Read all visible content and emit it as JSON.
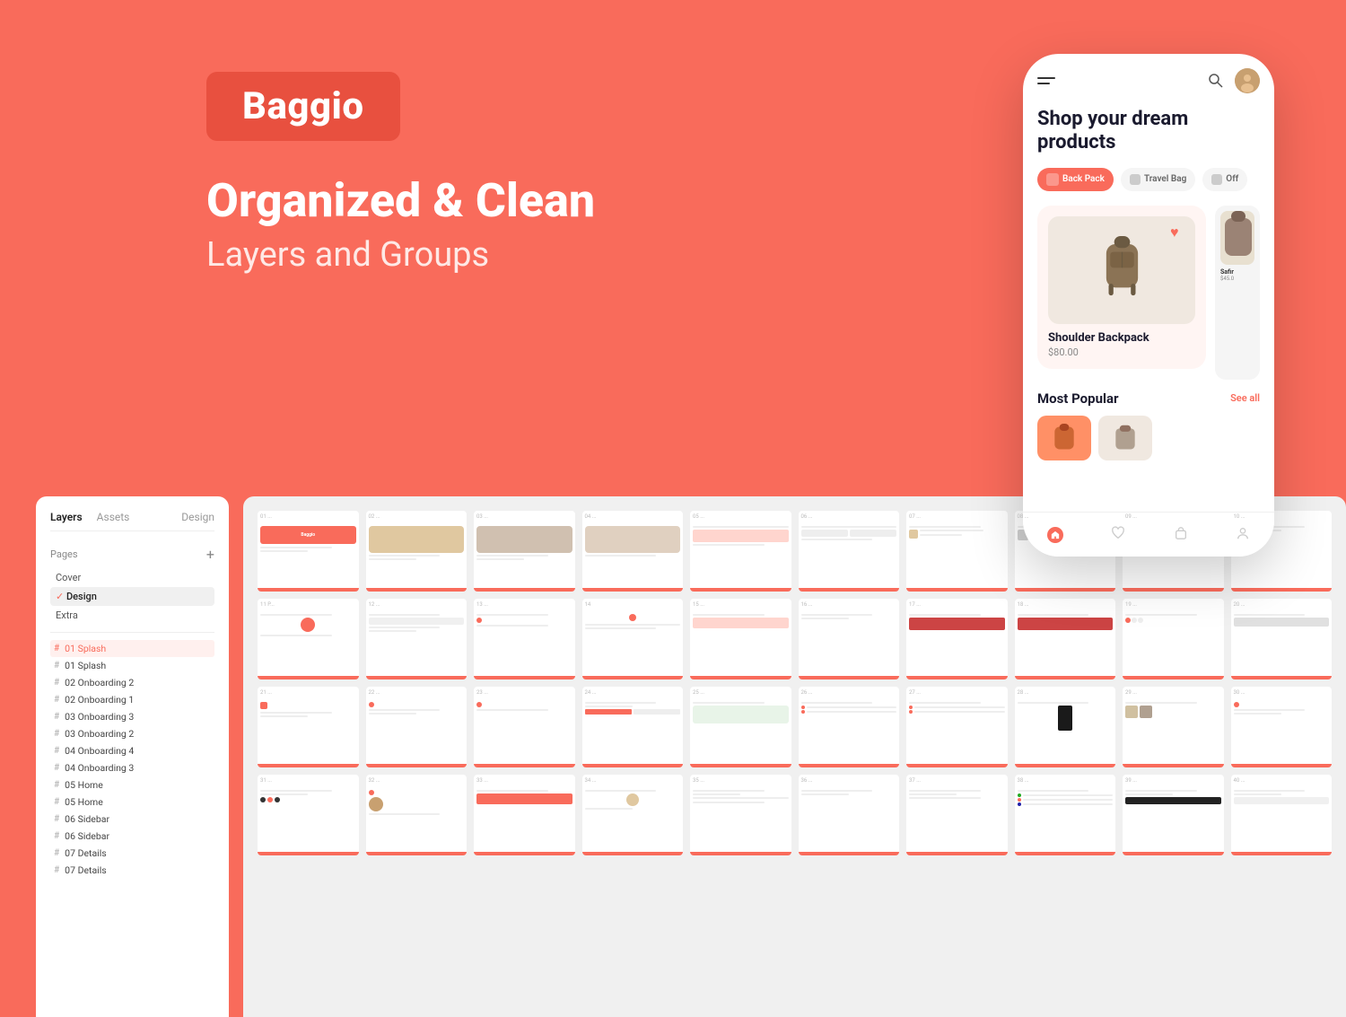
{
  "app": {
    "background_color": "#F96B5B"
  },
  "header": {
    "brand_name": "Baggio",
    "tagline_main": "Organized & Clean",
    "tagline_sub": "Layers and Groups"
  },
  "layers_panel": {
    "tabs": {
      "layers": "Layers",
      "assets": "Assets",
      "design": "Design"
    },
    "pages_label": "Pages",
    "pages_plus": "+",
    "pages": [
      {
        "name": "Cover",
        "active": false,
        "checked": false
      },
      {
        "name": "Design",
        "active": true,
        "checked": true
      },
      {
        "name": "Extra",
        "active": false,
        "checked": false
      }
    ],
    "layers": [
      {
        "hash": "#",
        "name": "01 Splash",
        "active": true
      },
      {
        "hash": "#",
        "name": "01 Splash",
        "active": false
      },
      {
        "hash": "#",
        "name": "02 Onboarding 2",
        "active": false
      },
      {
        "hash": "#",
        "name": "02 Onboarding 1",
        "active": false
      },
      {
        "hash": "#",
        "name": "03 Onboarding 3",
        "active": false
      },
      {
        "hash": "#",
        "name": "03 Onboarding 2",
        "active": false
      },
      {
        "hash": "#",
        "name": "04 Onboarding 4",
        "active": false
      },
      {
        "hash": "#",
        "name": "04 Onboarding 3",
        "active": false
      },
      {
        "hash": "#",
        "name": "05 Home",
        "active": false
      },
      {
        "hash": "#",
        "name": "05 Home",
        "active": false
      },
      {
        "hash": "#",
        "name": "06 Sidebar",
        "active": false
      },
      {
        "hash": "#",
        "name": "06 Sidebar",
        "active": false
      },
      {
        "hash": "#",
        "name": "07 Details",
        "active": false
      },
      {
        "hash": "#",
        "name": "07 Details",
        "active": false
      }
    ]
  },
  "phone": {
    "shop_title": "Shop your dream\nproducts",
    "categories": [
      "Back Pack",
      "Travel Bag",
      "Off"
    ],
    "product_name": "Shoulder Backpack",
    "product_price": "$80.00",
    "most_popular_label": "Most Popular",
    "see_all_label": "See all",
    "side_product_name": "Safir",
    "side_product_price": "$45.0"
  },
  "screen_rows": [
    {
      "nums": [
        "01 ...",
        "02 ...",
        "03 ...",
        "04 ...",
        "05 ...",
        "06 ...",
        "07 ...",
        "08 ...",
        "09 ...",
        "10 ..."
      ]
    },
    {
      "nums": [
        "11 P...",
        "12 ...",
        "13 ...",
        "14",
        "15 ...",
        "16 ...",
        "17 ...",
        "18 ...",
        "19 ...",
        "20 ..."
      ]
    },
    {
      "nums": [
        "21 ...",
        "22 ...",
        "23 ...",
        "24 ...",
        "25 ...",
        "26 ...",
        "27 ...",
        "28 ...",
        "29 ...",
        "30 ..."
      ]
    },
    {
      "nums": [
        "31 ...",
        "32 ...",
        "33 ...",
        "34 ...",
        "35 ...",
        "36 ...",
        "37 ...",
        "38 ...",
        "39 ...",
        "40 ..."
      ]
    }
  ]
}
